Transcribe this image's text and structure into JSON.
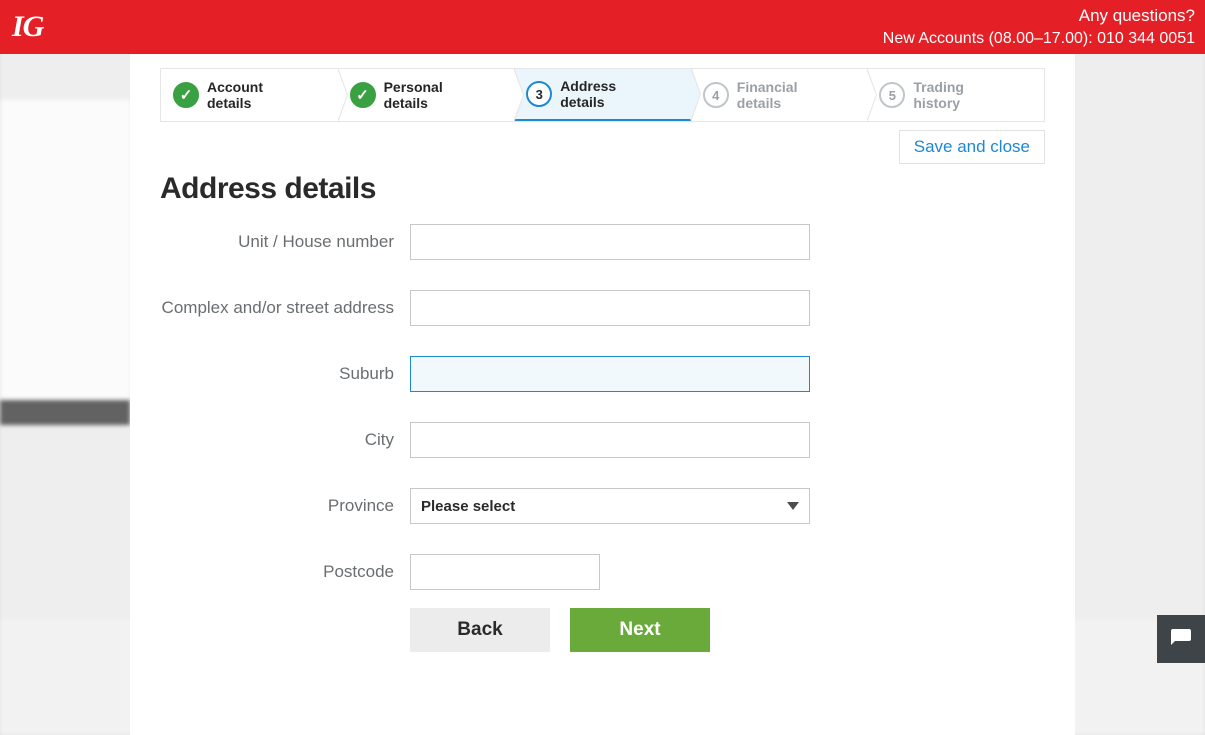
{
  "topbar": {
    "logo": "IG",
    "questions": "Any questions?",
    "hours_phone": "New Accounts (08.00–17.00): 010 344 0051"
  },
  "steps": [
    {
      "label": "Account details",
      "state": "done"
    },
    {
      "label": "Personal details",
      "state": "done"
    },
    {
      "num": "3",
      "label": "Address details",
      "state": "active"
    },
    {
      "num": "4",
      "label": "Financial details",
      "state": "future"
    },
    {
      "num": "5",
      "label": "Trading history",
      "state": "future"
    }
  ],
  "save_close": "Save and close",
  "title": "Address details",
  "fields": {
    "unit": {
      "label": "Unit / House number",
      "value": ""
    },
    "street": {
      "label": "Complex and/or street address",
      "value": ""
    },
    "suburb": {
      "label": "Suburb",
      "value": ""
    },
    "city": {
      "label": "City",
      "value": ""
    },
    "province": {
      "label": "Province",
      "selected": "Please select"
    },
    "postcode": {
      "label": "Postcode",
      "value": ""
    }
  },
  "buttons": {
    "back": "Back",
    "next": "Next"
  }
}
